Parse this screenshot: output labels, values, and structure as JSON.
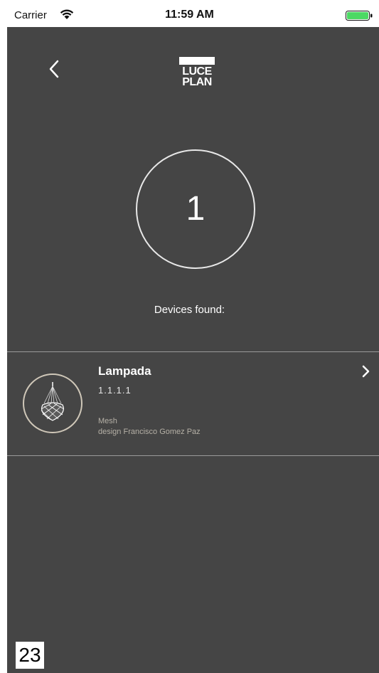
{
  "status_bar": {
    "carrier": "Carrier",
    "time": "11:59 AM",
    "battery_color": "#4cd964"
  },
  "header": {
    "back_icon": "chevron-left-icon",
    "logo_line1": "LUCE",
    "logo_line2": "PLAN"
  },
  "scan": {
    "count": "1",
    "label": "Devices found:"
  },
  "devices": [
    {
      "name": "Lampada",
      "version": "1.1.1.1",
      "model": "Mesh",
      "designer": "design Francisco Gomez Paz",
      "icon": "mesh-lamp-icon",
      "chevron_icon": "chevron-right-icon"
    }
  ],
  "page_number": "23",
  "colors": {
    "background": "#454545",
    "text": "#ffffff",
    "divider": "#9a9a9a",
    "thumb_border": "#cfc7b8"
  }
}
